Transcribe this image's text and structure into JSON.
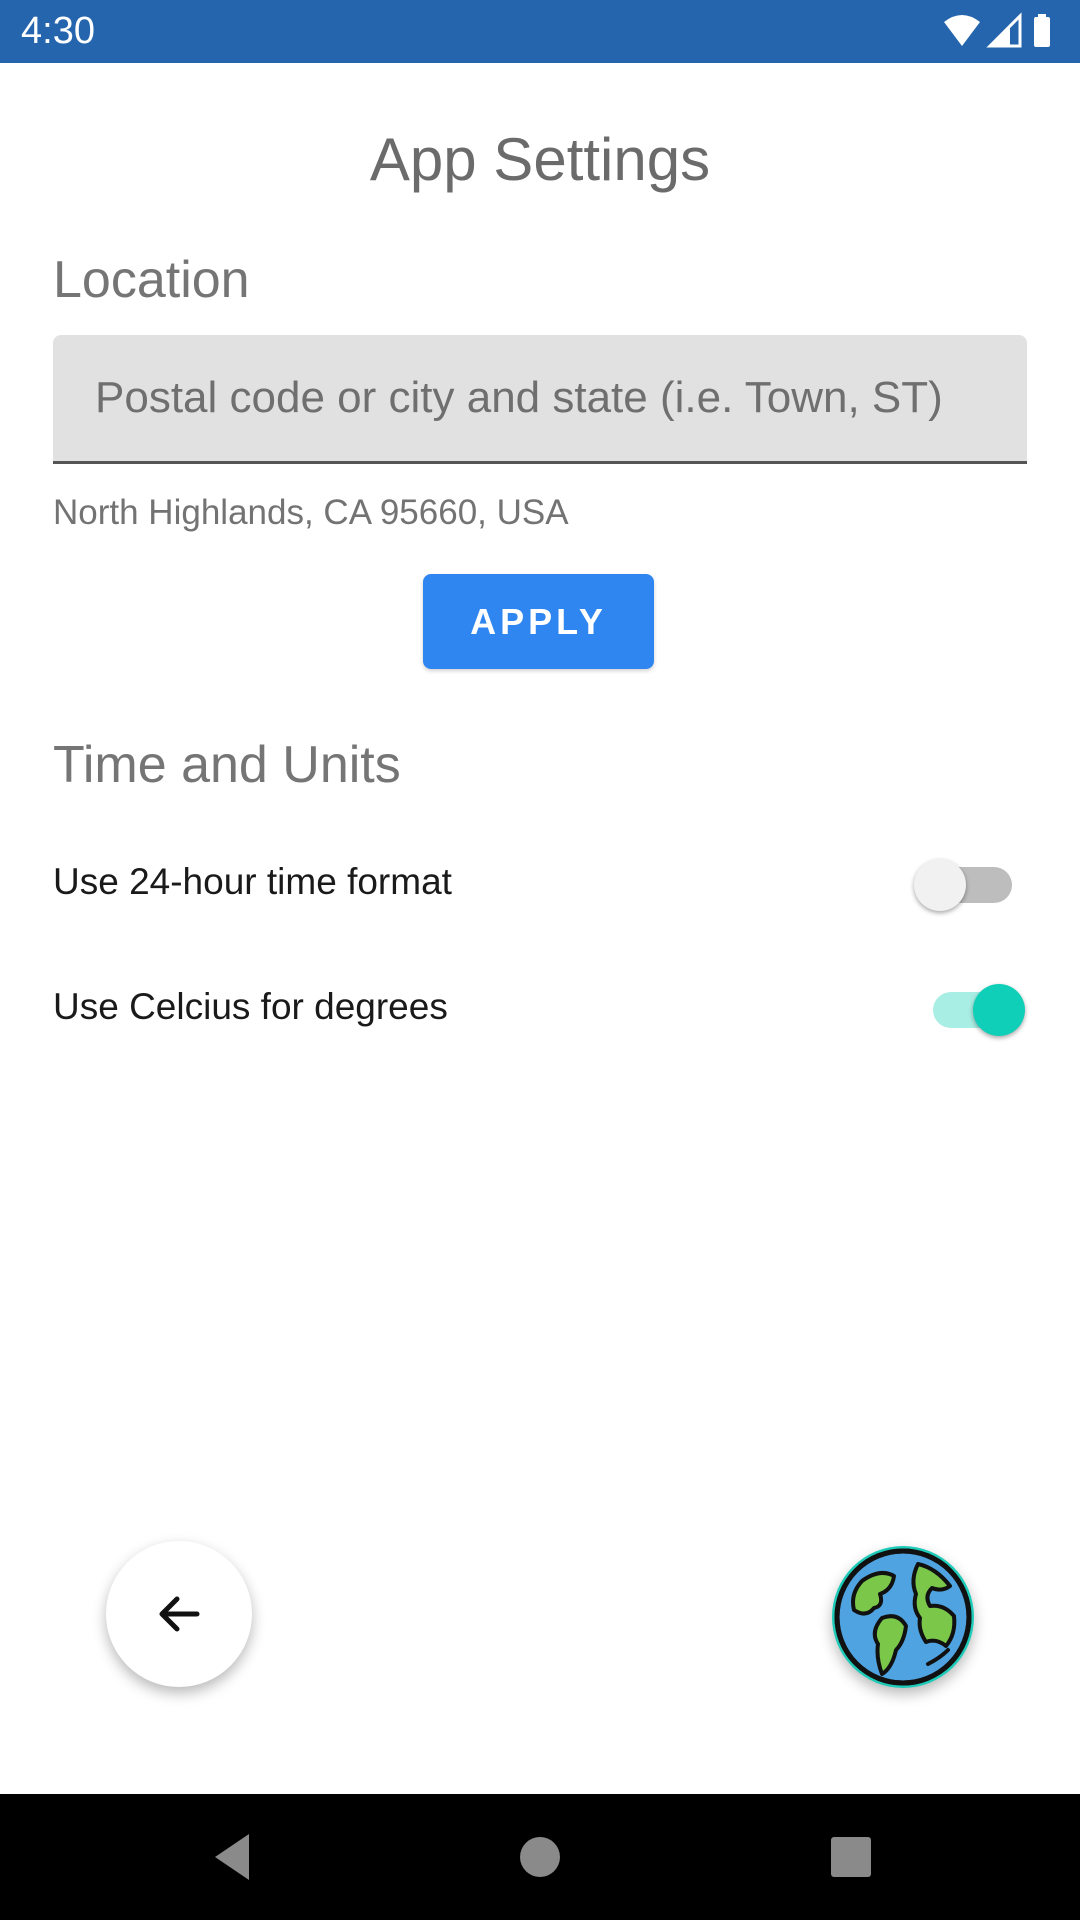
{
  "status_bar": {
    "time": "4:30",
    "icons": [
      "wifi-icon",
      "cell-signal-icon",
      "battery-icon"
    ],
    "background_color": "#2565AE"
  },
  "page": {
    "title": "App Settings"
  },
  "location_section": {
    "title": "Location",
    "input_value": "",
    "input_placeholder": "Postal code or city and state (i.e. Town, ST)",
    "current_location": "North Highlands, CA 95660, USA",
    "apply_label": "APPLY",
    "apply_color": "#2F86F0"
  },
  "time_units_section": {
    "title": "Time and Units",
    "settings": [
      {
        "label": "Use 24-hour time format",
        "enabled": false
      },
      {
        "label": "Use Celcius for degrees",
        "enabled": true
      }
    ],
    "toggle_on_color": "#0FCFB8"
  },
  "fabs": {
    "back_icon": "arrow-left-icon",
    "globe_icon": "globe-icon"
  },
  "nav_bar": {
    "buttons": [
      "back-triangle-icon",
      "home-circle-icon",
      "recents-square-icon"
    ]
  }
}
